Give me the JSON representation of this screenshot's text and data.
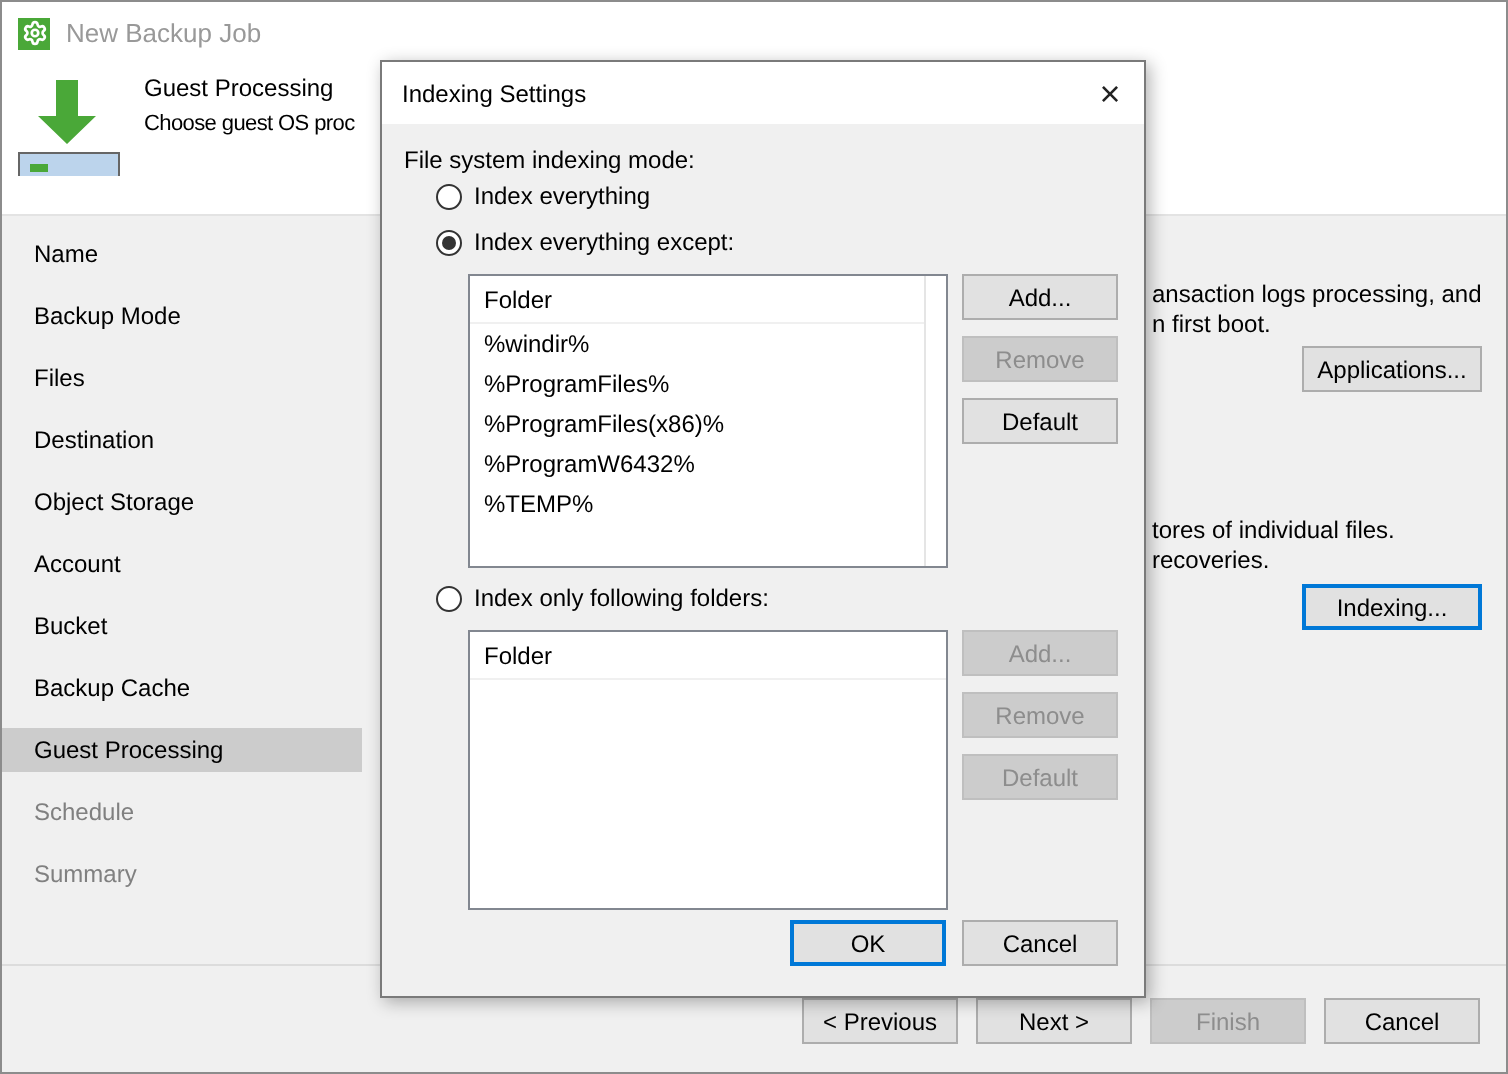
{
  "window": {
    "title": "New Backup Job"
  },
  "header": {
    "title": "Guest Processing",
    "subtitle": "Choose guest OS proc"
  },
  "sidebar": {
    "items": [
      {
        "label": "Name",
        "selected": false,
        "disabled": false
      },
      {
        "label": "Backup Mode",
        "selected": false,
        "disabled": false
      },
      {
        "label": "Files",
        "selected": false,
        "disabled": false
      },
      {
        "label": "Destination",
        "selected": false,
        "disabled": false
      },
      {
        "label": "Object Storage",
        "selected": false,
        "disabled": false
      },
      {
        "label": "Account",
        "selected": false,
        "disabled": false
      },
      {
        "label": "Bucket",
        "selected": false,
        "disabled": false
      },
      {
        "label": "Backup Cache",
        "selected": false,
        "disabled": false
      },
      {
        "label": "Guest Processing",
        "selected": true,
        "disabled": false
      },
      {
        "label": "Schedule",
        "selected": false,
        "disabled": true
      },
      {
        "label": "Summary",
        "selected": false,
        "disabled": true
      }
    ]
  },
  "content": {
    "text_1": [
      "ansaction logs processing, and",
      "n first boot."
    ],
    "applications_button": {
      "label": "Applications...",
      "focused": false
    },
    "text_2": [
      "tores of individual files.",
      "recoveries."
    ],
    "indexing_button": {
      "label": "Indexing...",
      "focused": true
    }
  },
  "footer_buttons": [
    {
      "label": "< Previous",
      "disabled": false
    },
    {
      "label": "Next >",
      "disabled": false
    },
    {
      "label": "Finish",
      "disabled": true
    },
    {
      "label": "Cancel",
      "disabled": false
    }
  ],
  "dialog": {
    "title": "Indexing Settings",
    "close": "×",
    "mode_label": "File system indexing mode:",
    "options": [
      {
        "label": "Index everything",
        "selected": false
      },
      {
        "label": "Index everything except:",
        "selected": true,
        "list": {
          "header": "Folder",
          "rows": [
            "%windir%",
            "%ProgramFiles%",
            "%ProgramFiles(x86)%",
            "%ProgramW6432%",
            "%TEMP%"
          ]
        },
        "buttons": [
          {
            "label": "Add...",
            "disabled": false
          },
          {
            "label": "Remove",
            "disabled": true
          },
          {
            "label": "Default",
            "disabled": false
          }
        ]
      },
      {
        "label": "Index only following folders:",
        "selected": false,
        "list": {
          "header": "Folder"
        },
        "buttons": [
          {
            "label": "Add...",
            "disabled": true
          },
          {
            "label": "Remove",
            "disabled": true
          },
          {
            "label": "Default",
            "disabled": true
          }
        ]
      }
    ],
    "buttons": [
      {
        "label": "OK",
        "focused": true
      },
      {
        "label": "Cancel",
        "focused": false
      }
    ]
  }
}
